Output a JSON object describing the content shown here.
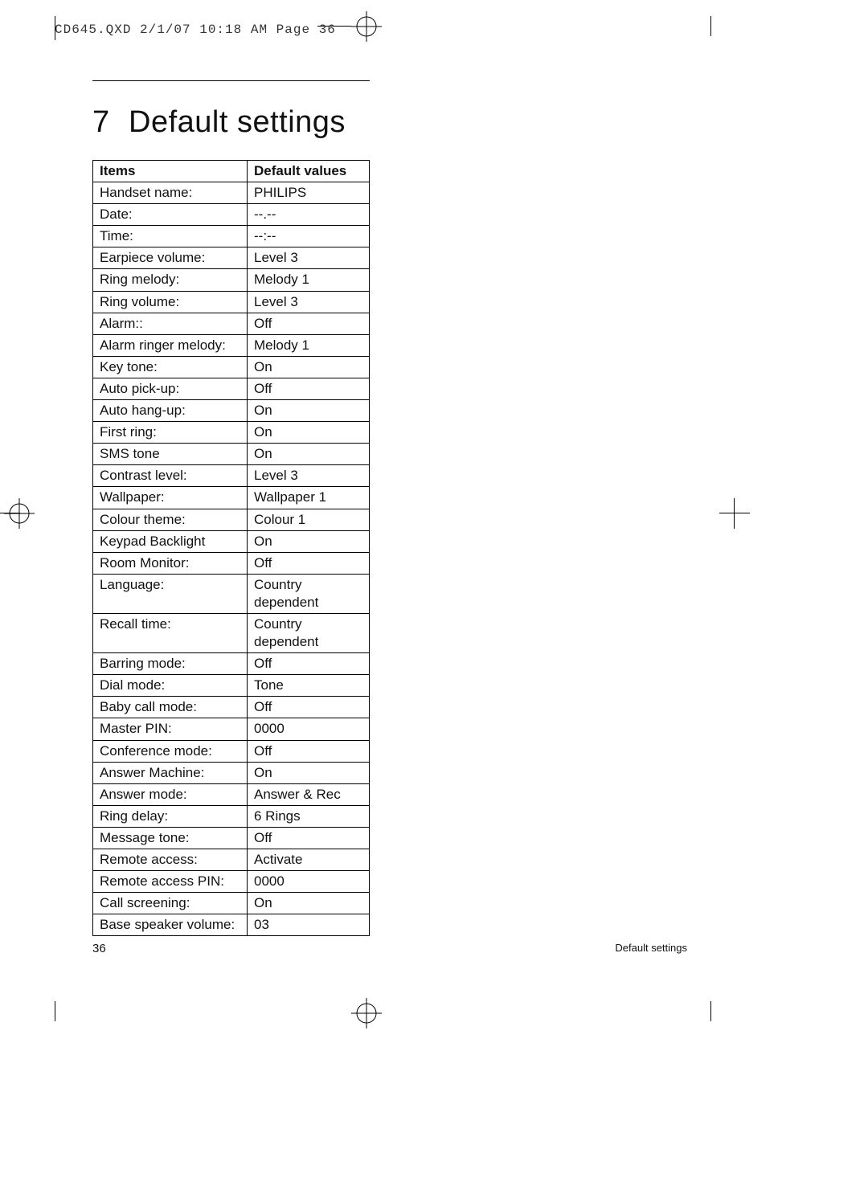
{
  "print_header": "CD645.QXD  2/1/07  10:18 AM  Page 36",
  "chapter": {
    "number": "7",
    "title": "Default settings"
  },
  "table": {
    "headers": [
      "Items",
      "Default values"
    ],
    "rows": [
      [
        "Handset name:",
        "PHILIPS"
      ],
      [
        "Date:",
        "--.--"
      ],
      [
        "Time:",
        "--:--"
      ],
      [
        "Earpiece volume:",
        "Level 3"
      ],
      [
        "Ring melody:",
        "Melody 1"
      ],
      [
        "Ring volume:",
        "Level 3"
      ],
      [
        "Alarm::",
        "Off"
      ],
      [
        "Alarm ringer melody:",
        "Melody 1"
      ],
      [
        "Key tone:",
        "On"
      ],
      [
        "Auto pick-up:",
        "Off"
      ],
      [
        "Auto hang-up:",
        "On"
      ],
      [
        "First ring:",
        "On"
      ],
      [
        "SMS tone",
        "On"
      ],
      [
        "Contrast level:",
        "Level 3"
      ],
      [
        "Wallpaper:",
        "Wallpaper 1"
      ],
      [
        "Colour theme:",
        "Colour 1"
      ],
      [
        "Keypad Backlight",
        "On"
      ],
      [
        "Room Monitor:",
        "Off"
      ],
      [
        "Language:",
        "Country dependent"
      ],
      [
        "Recall time:",
        "Country dependent"
      ],
      [
        "Barring mode:",
        "Off"
      ],
      [
        "Dial mode:",
        "Tone"
      ],
      [
        "Baby call mode:",
        "Off"
      ],
      [
        "Master PIN:",
        "0000"
      ],
      [
        "Conference mode:",
        "Off"
      ],
      [
        "Answer Machine:",
        "On"
      ],
      [
        "Answer mode:",
        "Answer & Rec"
      ],
      [
        "Ring delay:",
        "6 Rings"
      ],
      [
        "Message tone:",
        "Off"
      ],
      [
        "Remote access:",
        "Activate"
      ],
      [
        "Remote access PIN:",
        "0000"
      ],
      [
        "Call screening:",
        "On"
      ],
      [
        "Base speaker volume:",
        "03"
      ]
    ]
  },
  "footer": {
    "page_number": "36",
    "section": "Default settings"
  }
}
